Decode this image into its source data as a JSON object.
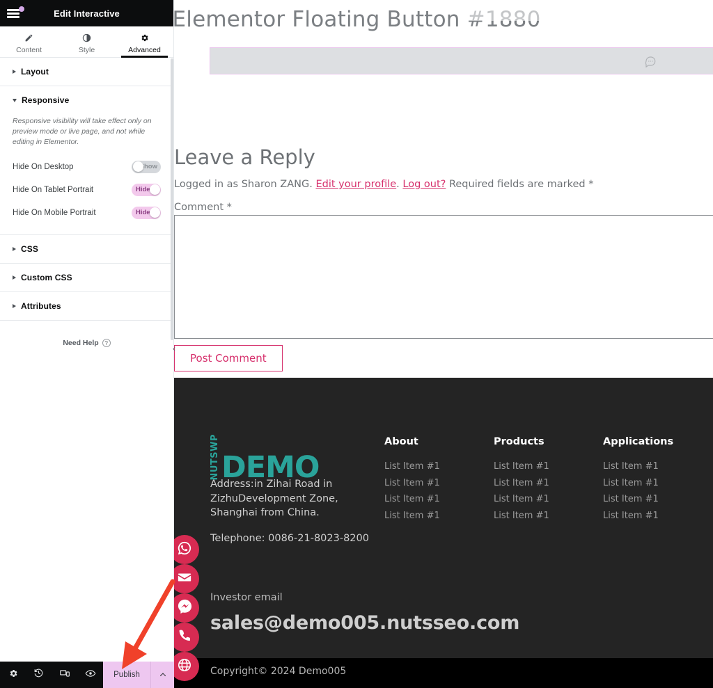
{
  "panel": {
    "header_title": "Edit Interactive",
    "menu_icon": "hamburger-menu-icon",
    "tabs": [
      {
        "label": "Content",
        "icon": "pencil-icon",
        "active": false
      },
      {
        "label": "Style",
        "icon": "contrast-half-circle-icon",
        "active": false
      },
      {
        "label": "Advanced",
        "icon": "gear-icon",
        "active": true
      }
    ],
    "sections": [
      {
        "label": "Layout",
        "open": false
      },
      {
        "label": "Responsive",
        "open": true
      },
      {
        "label": "CSS",
        "open": false
      },
      {
        "label": "Custom CSS",
        "open": false
      },
      {
        "label": "Attributes",
        "open": false
      }
    ],
    "responsive": {
      "note": "Responsive visibility will take effect only on preview mode or live page, and not while editing in Elementor.",
      "controls": [
        {
          "label": "Hide On Desktop",
          "state": "Show",
          "on": false
        },
        {
          "label": "Hide On Tablet Portrait",
          "state": "Hide",
          "on": true
        },
        {
          "label": "Hide On Mobile Portrait",
          "state": "Hide",
          "on": true
        }
      ]
    },
    "need_help": "Need Help",
    "footer": {
      "icons": [
        {
          "name": "settings-gear-icon"
        },
        {
          "name": "history-icon"
        },
        {
          "name": "responsive-mode-icon"
        },
        {
          "name": "preview-eye-icon"
        }
      ],
      "publish_label": "Publish",
      "publish_caret": "chevron-up-icon"
    },
    "collapse_chevron": "‹"
  },
  "canvas": {
    "post_title": "Elementor Floating Button #1880",
    "comment_bar_icon": "comment-bubble-icon",
    "reply": {
      "heading": "Leave a Reply",
      "logged_in_prefix": "Logged in as Sharon ZANG.",
      "edit_profile": "Edit your profile",
      "separator": ".",
      "log_out": "Log out?",
      "required_note": "Required fields are marked *",
      "comment_label": "Comment *",
      "comment_value": "",
      "post_button": "Post Comment"
    },
    "footer": {
      "logo_vertical": "NUTSWP",
      "logo_main": "DEMO",
      "address": "Address:in Zihai Road in ZizhuDevelopment Zone, Shanghai from China.",
      "telephone": "Telephone: 0086-21-8023-8200",
      "columns": [
        {
          "heading": "About",
          "items": [
            "List Item #1",
            "List Item #1",
            "List Item #1",
            "List Item #1"
          ]
        },
        {
          "heading": "Products",
          "items": [
            "List Item #1",
            "List Item #1",
            "List Item #1",
            "List Item #1"
          ]
        },
        {
          "heading": "Applications",
          "items": [
            "List Item #1",
            "List Item #1",
            "List Item #1",
            "List Item #1"
          ]
        }
      ],
      "investor_label": "Investor email",
      "investor_email": "sales@demo005.nutsseo.com",
      "copyright": "Copyright© 2024 Demo005"
    },
    "floating_buttons": [
      {
        "name": "whatsapp-icon"
      },
      {
        "name": "email-icon"
      },
      {
        "name": "messenger-icon"
      },
      {
        "name": "phone-icon"
      },
      {
        "name": "globe-icon"
      }
    ]
  },
  "colors": {
    "panel_dark": "#0c0d0e",
    "accent_pink": "#d6306c",
    "publish_bg": "#eec7f0",
    "toggle_on": "#f3c9ec",
    "toggle_off": "#d5d8dc",
    "footer_bg": "#242424",
    "logo_teal": "#2aa39a",
    "floater_red": "#d72b52",
    "annotation_red": "#f0412a"
  }
}
